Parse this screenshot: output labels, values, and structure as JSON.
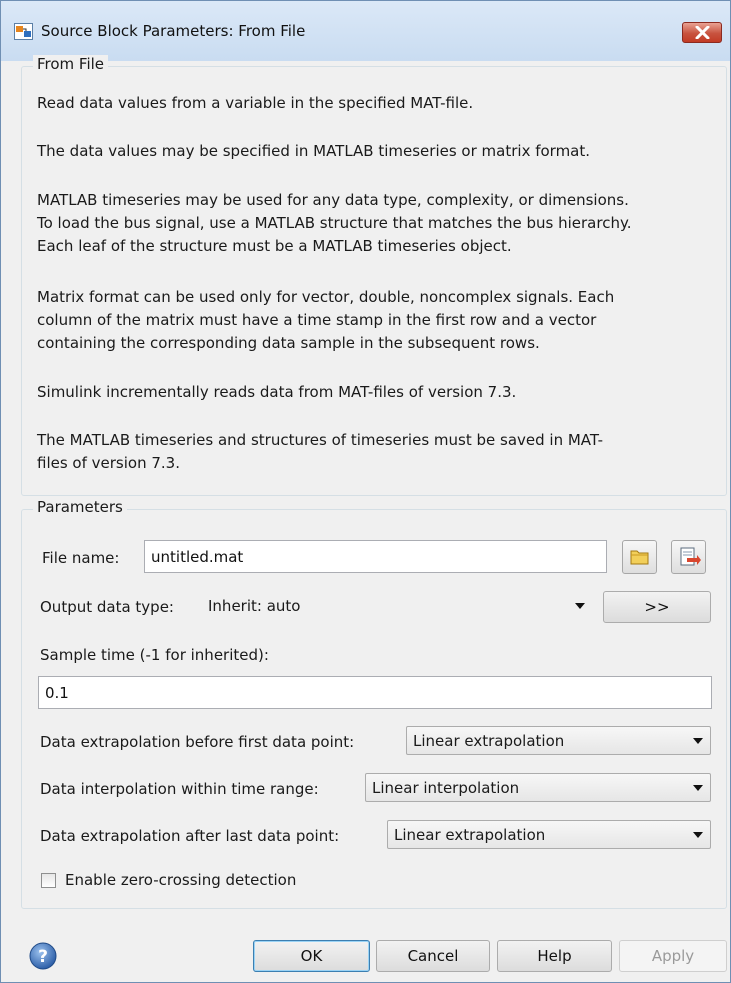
{
  "window": {
    "title": "Source Block Parameters: From File",
    "accent": "#c8533f"
  },
  "description_group": {
    "legend": "From File",
    "paragraphs": [
      "Read data values from a variable in the specified MAT-file.",
      "The data values may be specified in MATLAB timeseries or matrix format.",
      "MATLAB timeseries may be used for any data type, complexity, or dimensions.",
      "To load the bus signal, use a MATLAB structure that matches the bus hierarchy.",
      "Each leaf of the structure must be a MATLAB timeseries object.",
      "Matrix format can be used only for vector, double, noncomplex  signals. Each",
      "column of the matrix must have a time stamp in the first row and a vector",
      "containing the corresponding data sample in the subsequent rows.",
      "Simulink incrementally reads data from MAT-files of version 7.3.",
      "The MATLAB timeseries and structures of timeseries must be saved in MAT-",
      "files of version 7.3."
    ]
  },
  "parameters": {
    "legend": "Parameters",
    "file_name": {
      "label": "File name:",
      "value": "untitled.mat"
    },
    "output_type": {
      "label": "Output data type:",
      "value": "Inherit: auto",
      "assistant_button": ">>"
    },
    "sample_time": {
      "label": "Sample time (-1 for inherited):",
      "value": "0.1"
    },
    "extrap_before": {
      "label": "Data extrapolation before first data point:",
      "value": "Linear extrapolation"
    },
    "interp_within": {
      "label": "Data interpolation within time range:",
      "value": "Linear interpolation"
    },
    "extrap_after": {
      "label": "Data extrapolation after last data point:",
      "value": "Linear extrapolation"
    },
    "zero_crossing": {
      "label": "Enable zero-crossing detection",
      "checked": false
    }
  },
  "footer": {
    "ok": "OK",
    "cancel": "Cancel",
    "help": "Help",
    "apply": "Apply"
  },
  "icons": {
    "window_icon": "simulink-block-icon",
    "close": "close-icon",
    "browse": "folder-icon",
    "load": "load-file-icon",
    "help": "help-circle-icon"
  }
}
